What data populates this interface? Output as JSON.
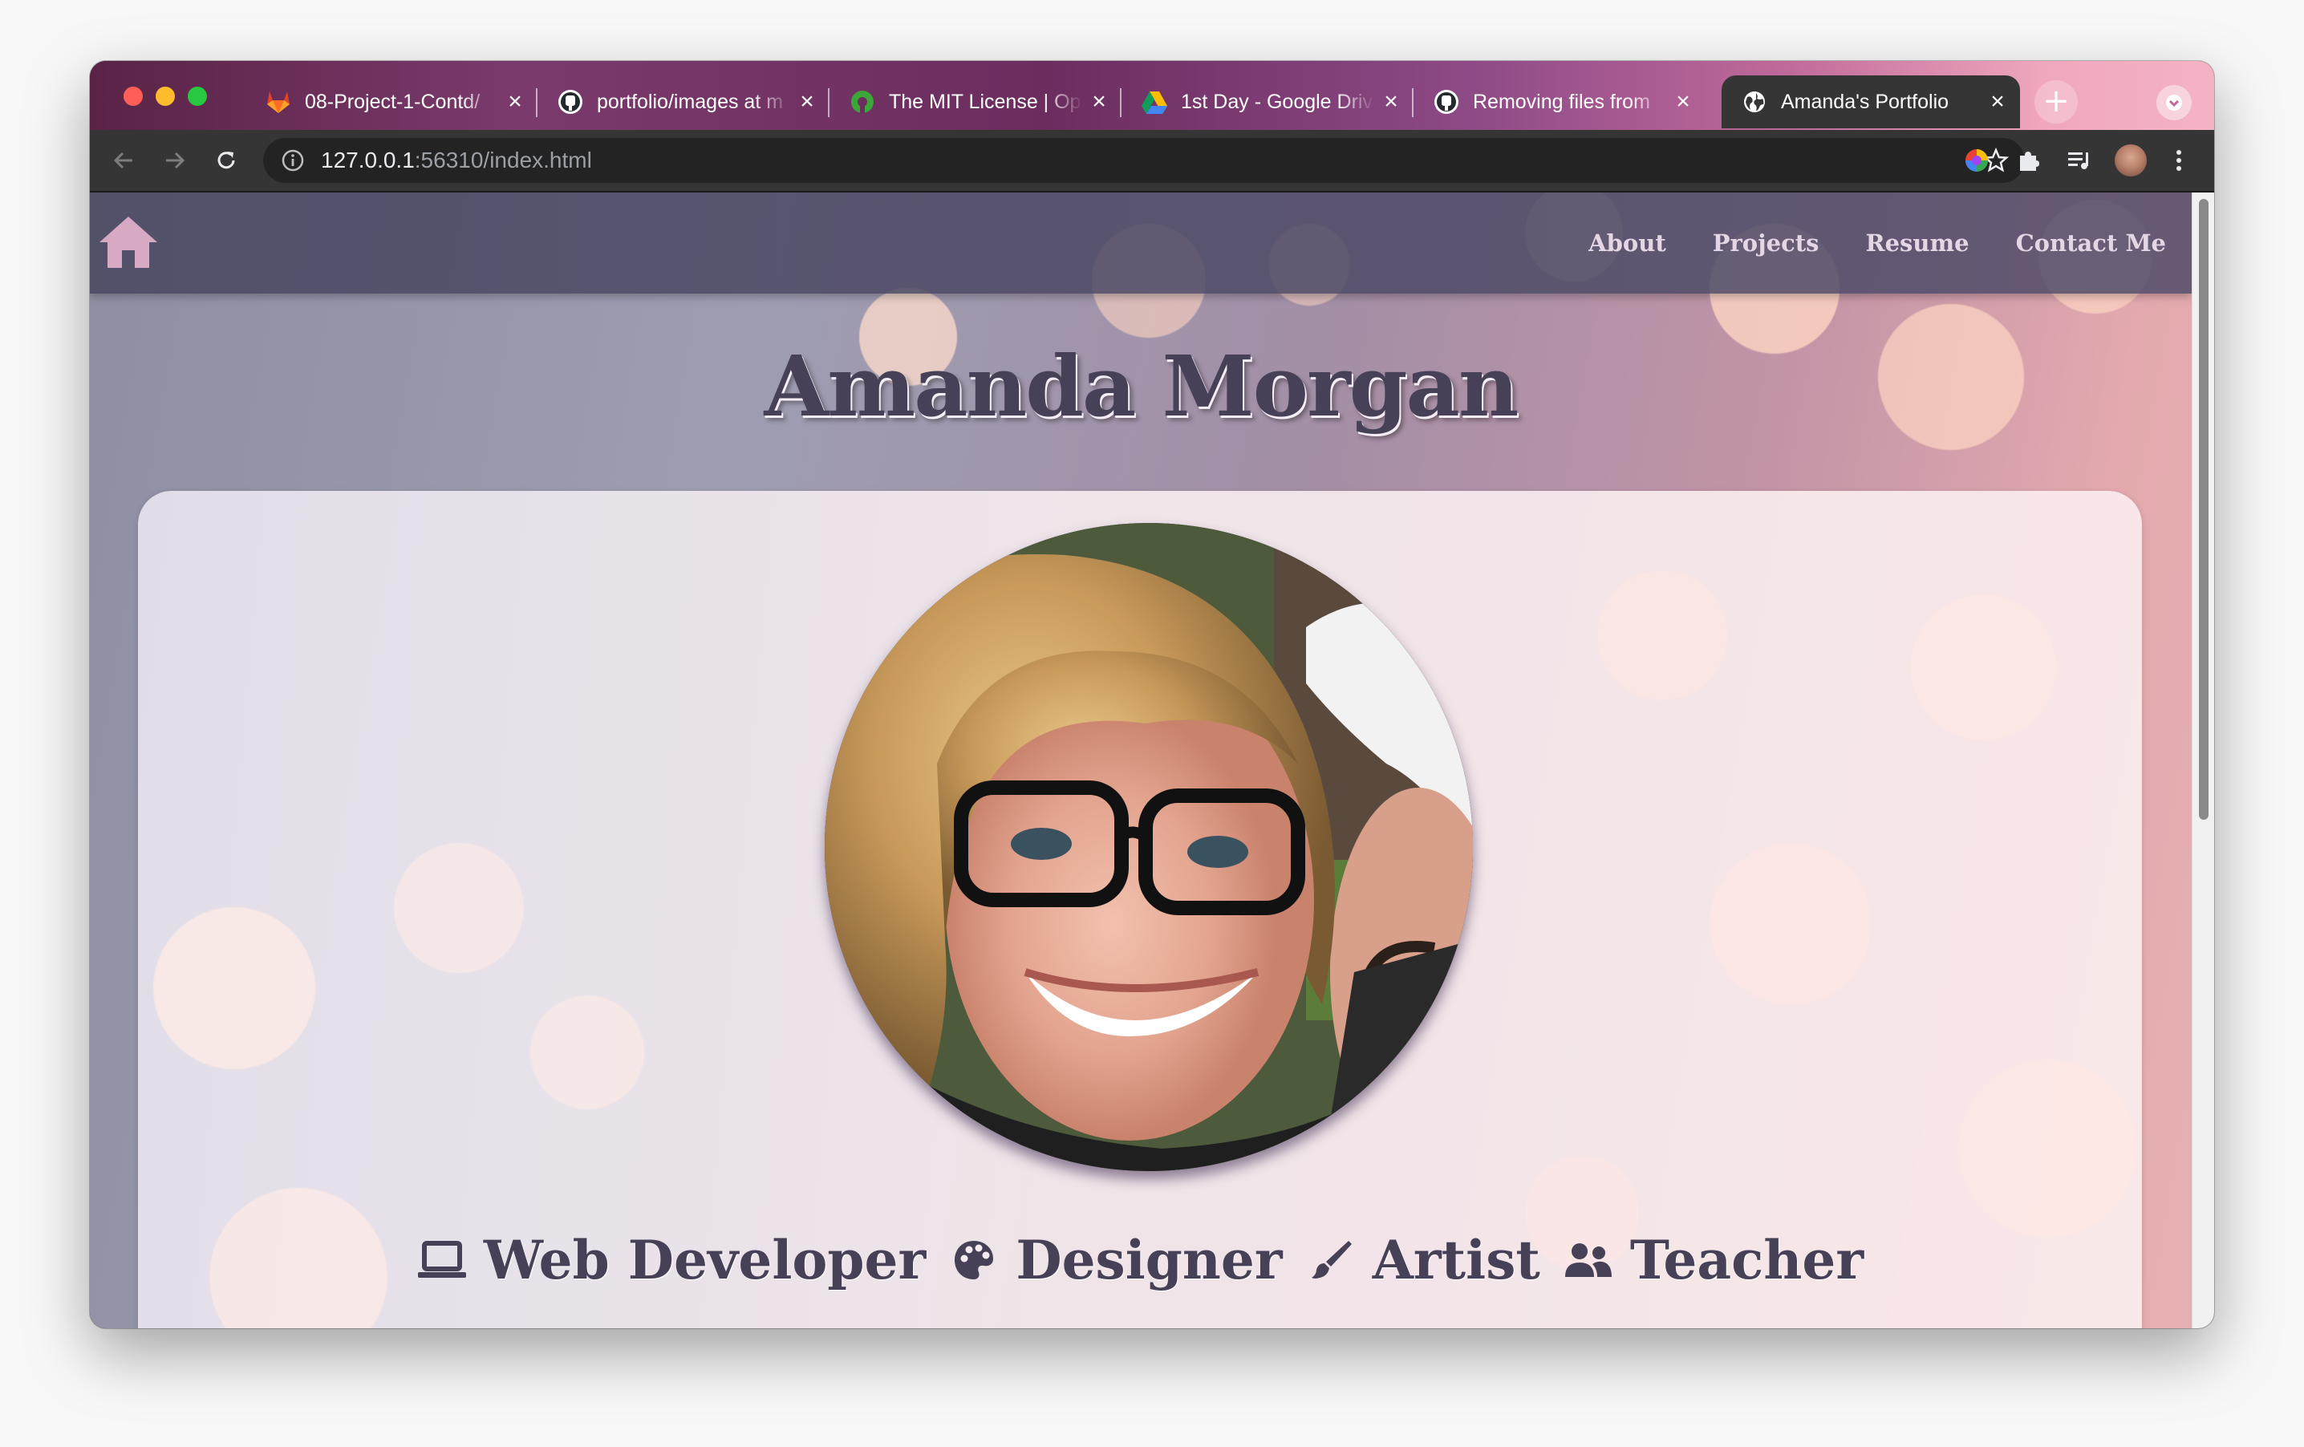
{
  "browser": {
    "tabs": [
      {
        "title": "08-Project-1-Contd/",
        "favicon": "gitlab-icon"
      },
      {
        "title": "portfolio/images at m",
        "favicon": "github-icon"
      },
      {
        "title": "The MIT License | Op",
        "favicon": "osi-icon"
      },
      {
        "title": "1st Day - Google Driv",
        "favicon": "google-drive-icon"
      },
      {
        "title": "Removing files from",
        "favicon": "github-icon"
      },
      {
        "title": "Amanda's Portfolio",
        "favicon": "globe-icon",
        "active": true
      }
    ],
    "new_tab_label": "+",
    "address": {
      "host": "127.0.0.1",
      "rest": ":56310/index.html"
    }
  },
  "site": {
    "nav": {
      "home_icon": "home-icon",
      "links": [
        "About",
        "Projects",
        "Resume",
        "Contact Me"
      ]
    },
    "name": "Amanda Morgan",
    "roles": [
      {
        "label": "Web Developer",
        "icon": "laptop-icon"
      },
      {
        "label": "Designer",
        "icon": "palette-icon"
      },
      {
        "label": "Artist",
        "icon": "paintbrush-icon"
      },
      {
        "label": "Teacher",
        "icon": "users-icon"
      }
    ]
  },
  "colors": {
    "heading": "#474157",
    "nav_link": "#e4d6e4",
    "home_icon": "#d8a9c2",
    "navbar": "#4f4c69"
  }
}
